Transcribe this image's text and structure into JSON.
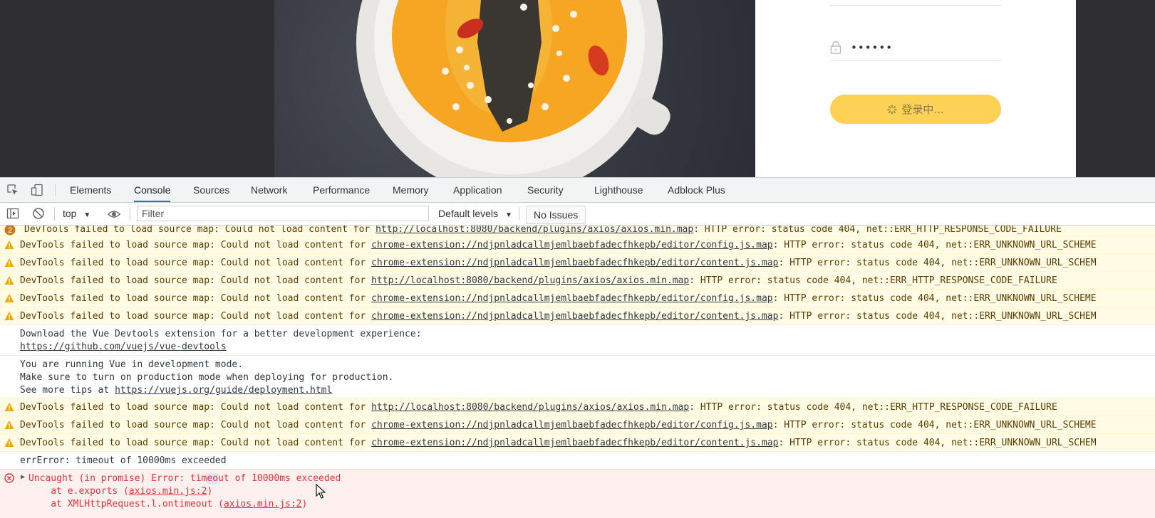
{
  "login": {
    "password_value": "••••••",
    "button_label": "登录中..."
  },
  "devtools": {
    "tabs": [
      "Elements",
      "Console",
      "Sources",
      "Network",
      "Performance",
      "Memory",
      "Application",
      "Security",
      "Lighthouse",
      "Adblock Plus"
    ],
    "active_tab": "Console",
    "context": "top",
    "filter_placeholder": "Filter",
    "levels": "Default levels",
    "issues": "No Issues",
    "colors": {
      "accent": "#1a73e8",
      "warning_bg": "#fffbe5",
      "error_bg": "#fff0f0",
      "error_text": "#e3343a"
    }
  },
  "console": {
    "warn_prefix": "DevTools failed to load source map: Could not load content for ",
    "group_badge": "2",
    "warnings": [
      {
        "url": "http://localhost:8080/backend/plugins/axios/axios.min.map",
        "suffix": ": HTTP error: status code 404, net::ERR_HTTP_RESPONSE_CODE_FAILURE"
      },
      {
        "url": "chrome-extension://ndjpnladcallmjemlbaebfadecfhkepb/editor/config.js.map",
        "suffix": ": HTTP error: status code 404, net::ERR_UNKNOWN_URL_SCHEME"
      },
      {
        "url": "chrome-extension://ndjpnladcallmjemlbaebfadecfhkepb/editor/content.js.map",
        "suffix": ": HTTP error: status code 404, net::ERR_UNKNOWN_URL_SCHEM"
      },
      {
        "url": "http://localhost:8080/backend/plugins/axios/axios.min.map",
        "suffix": ": HTTP error: status code 404, net::ERR_HTTP_RESPONSE_CODE_FAILURE"
      },
      {
        "url": "chrome-extension://ndjpnladcallmjemlbaebfadecfhkepb/editor/config.js.map",
        "suffix": ": HTTP error: status code 404, net::ERR_UNKNOWN_URL_SCHEME"
      },
      {
        "url": "chrome-extension://ndjpnladcallmjemlbaebfadecfhkepb/editor/content.js.map",
        "suffix": ": HTTP error: status code 404, net::ERR_UNKNOWN_URL_SCHEM"
      },
      {
        "url": "http://localhost:8080/backend/plugins/axios/axios.min.map",
        "suffix": ": HTTP error: status code 404, net::ERR_HTTP_RESPONSE_CODE_FAILURE"
      },
      {
        "url": "chrome-extension://ndjpnladcallmjemlbaebfadecfhkepb/editor/config.js.map",
        "suffix": ": HTTP error: status code 404, net::ERR_UNKNOWN_URL_SCHEME"
      },
      {
        "url": "chrome-extension://ndjpnladcallmjemlbaebfadecfhkepb/editor/content.js.map",
        "suffix": ": HTTP error: status code 404, net::ERR_UNKNOWN_URL_SCHEM"
      }
    ],
    "vue_devtools": {
      "line1": "Download the Vue Devtools extension for a better development experience:",
      "url": "https://github.com/vuejs/vue-devtools"
    },
    "vue_dev_mode": {
      "line1": "You are running Vue in development mode.",
      "line2": "Make sure to turn on production mode when deploying for production.",
      "line3_prefix": "See more tips at ",
      "url": "https://vuejs.org/guide/deployment.html"
    },
    "err_log": "errError: timeout of 10000ms exceeded",
    "uncaught": {
      "msg_a": "Uncaught (in promise) Error: tim",
      "msg_b": "eo",
      "msg_c": "ut of 10000ms exceeded",
      "stack1_prefix": "    at e.exports (",
      "stack1_link": "axios.min.js:2",
      "stack2_prefix": "    at XMLHttpRequest.l.ontimeout (",
      "stack2_link": "axios.min.js:2",
      "close_paren": ")"
    }
  }
}
